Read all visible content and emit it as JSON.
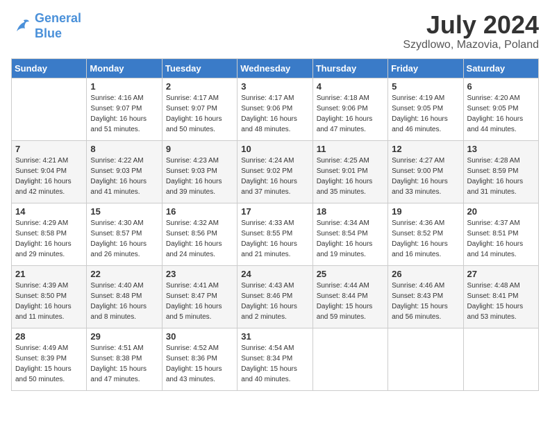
{
  "header": {
    "logo_line1": "General",
    "logo_line2": "Blue",
    "month": "July 2024",
    "location": "Szydlowo, Mazovia, Poland"
  },
  "weekdays": [
    "Sunday",
    "Monday",
    "Tuesday",
    "Wednesday",
    "Thursday",
    "Friday",
    "Saturday"
  ],
  "weeks": [
    [
      {
        "day": "",
        "sunrise": "",
        "sunset": "",
        "daylight": ""
      },
      {
        "day": "1",
        "sunrise": "Sunrise: 4:16 AM",
        "sunset": "Sunset: 9:07 PM",
        "daylight": "Daylight: 16 hours and 51 minutes."
      },
      {
        "day": "2",
        "sunrise": "Sunrise: 4:17 AM",
        "sunset": "Sunset: 9:07 PM",
        "daylight": "Daylight: 16 hours and 50 minutes."
      },
      {
        "day": "3",
        "sunrise": "Sunrise: 4:17 AM",
        "sunset": "Sunset: 9:06 PM",
        "daylight": "Daylight: 16 hours and 48 minutes."
      },
      {
        "day": "4",
        "sunrise": "Sunrise: 4:18 AM",
        "sunset": "Sunset: 9:06 PM",
        "daylight": "Daylight: 16 hours and 47 minutes."
      },
      {
        "day": "5",
        "sunrise": "Sunrise: 4:19 AM",
        "sunset": "Sunset: 9:05 PM",
        "daylight": "Daylight: 16 hours and 46 minutes."
      },
      {
        "day": "6",
        "sunrise": "Sunrise: 4:20 AM",
        "sunset": "Sunset: 9:05 PM",
        "daylight": "Daylight: 16 hours and 44 minutes."
      }
    ],
    [
      {
        "day": "7",
        "sunrise": "Sunrise: 4:21 AM",
        "sunset": "Sunset: 9:04 PM",
        "daylight": "Daylight: 16 hours and 42 minutes."
      },
      {
        "day": "8",
        "sunrise": "Sunrise: 4:22 AM",
        "sunset": "Sunset: 9:03 PM",
        "daylight": "Daylight: 16 hours and 41 minutes."
      },
      {
        "day": "9",
        "sunrise": "Sunrise: 4:23 AM",
        "sunset": "Sunset: 9:03 PM",
        "daylight": "Daylight: 16 hours and 39 minutes."
      },
      {
        "day": "10",
        "sunrise": "Sunrise: 4:24 AM",
        "sunset": "Sunset: 9:02 PM",
        "daylight": "Daylight: 16 hours and 37 minutes."
      },
      {
        "day": "11",
        "sunrise": "Sunrise: 4:25 AM",
        "sunset": "Sunset: 9:01 PM",
        "daylight": "Daylight: 16 hours and 35 minutes."
      },
      {
        "day": "12",
        "sunrise": "Sunrise: 4:27 AM",
        "sunset": "Sunset: 9:00 PM",
        "daylight": "Daylight: 16 hours and 33 minutes."
      },
      {
        "day": "13",
        "sunrise": "Sunrise: 4:28 AM",
        "sunset": "Sunset: 8:59 PM",
        "daylight": "Daylight: 16 hours and 31 minutes."
      }
    ],
    [
      {
        "day": "14",
        "sunrise": "Sunrise: 4:29 AM",
        "sunset": "Sunset: 8:58 PM",
        "daylight": "Daylight: 16 hours and 29 minutes."
      },
      {
        "day": "15",
        "sunrise": "Sunrise: 4:30 AM",
        "sunset": "Sunset: 8:57 PM",
        "daylight": "Daylight: 16 hours and 26 minutes."
      },
      {
        "day": "16",
        "sunrise": "Sunrise: 4:32 AM",
        "sunset": "Sunset: 8:56 PM",
        "daylight": "Daylight: 16 hours and 24 minutes."
      },
      {
        "day": "17",
        "sunrise": "Sunrise: 4:33 AM",
        "sunset": "Sunset: 8:55 PM",
        "daylight": "Daylight: 16 hours and 21 minutes."
      },
      {
        "day": "18",
        "sunrise": "Sunrise: 4:34 AM",
        "sunset": "Sunset: 8:54 PM",
        "daylight": "Daylight: 16 hours and 19 minutes."
      },
      {
        "day": "19",
        "sunrise": "Sunrise: 4:36 AM",
        "sunset": "Sunset: 8:52 PM",
        "daylight": "Daylight: 16 hours and 16 minutes."
      },
      {
        "day": "20",
        "sunrise": "Sunrise: 4:37 AM",
        "sunset": "Sunset: 8:51 PM",
        "daylight": "Daylight: 16 hours and 14 minutes."
      }
    ],
    [
      {
        "day": "21",
        "sunrise": "Sunrise: 4:39 AM",
        "sunset": "Sunset: 8:50 PM",
        "daylight": "Daylight: 16 hours and 11 minutes."
      },
      {
        "day": "22",
        "sunrise": "Sunrise: 4:40 AM",
        "sunset": "Sunset: 8:48 PM",
        "daylight": "Daylight: 16 hours and 8 minutes."
      },
      {
        "day": "23",
        "sunrise": "Sunrise: 4:41 AM",
        "sunset": "Sunset: 8:47 PM",
        "daylight": "Daylight: 16 hours and 5 minutes."
      },
      {
        "day": "24",
        "sunrise": "Sunrise: 4:43 AM",
        "sunset": "Sunset: 8:46 PM",
        "daylight": "Daylight: 16 hours and 2 minutes."
      },
      {
        "day": "25",
        "sunrise": "Sunrise: 4:44 AM",
        "sunset": "Sunset: 8:44 PM",
        "daylight": "Daylight: 15 hours and 59 minutes."
      },
      {
        "day": "26",
        "sunrise": "Sunrise: 4:46 AM",
        "sunset": "Sunset: 8:43 PM",
        "daylight": "Daylight: 15 hours and 56 minutes."
      },
      {
        "day": "27",
        "sunrise": "Sunrise: 4:48 AM",
        "sunset": "Sunset: 8:41 PM",
        "daylight": "Daylight: 15 hours and 53 minutes."
      }
    ],
    [
      {
        "day": "28",
        "sunrise": "Sunrise: 4:49 AM",
        "sunset": "Sunset: 8:39 PM",
        "daylight": "Daylight: 15 hours and 50 minutes."
      },
      {
        "day": "29",
        "sunrise": "Sunrise: 4:51 AM",
        "sunset": "Sunset: 8:38 PM",
        "daylight": "Daylight: 15 hours and 47 minutes."
      },
      {
        "day": "30",
        "sunrise": "Sunrise: 4:52 AM",
        "sunset": "Sunset: 8:36 PM",
        "daylight": "Daylight: 15 hours and 43 minutes."
      },
      {
        "day": "31",
        "sunrise": "Sunrise: 4:54 AM",
        "sunset": "Sunset: 8:34 PM",
        "daylight": "Daylight: 15 hours and 40 minutes."
      },
      {
        "day": "",
        "sunrise": "",
        "sunset": "",
        "daylight": ""
      },
      {
        "day": "",
        "sunrise": "",
        "sunset": "",
        "daylight": ""
      },
      {
        "day": "",
        "sunrise": "",
        "sunset": "",
        "daylight": ""
      }
    ]
  ]
}
